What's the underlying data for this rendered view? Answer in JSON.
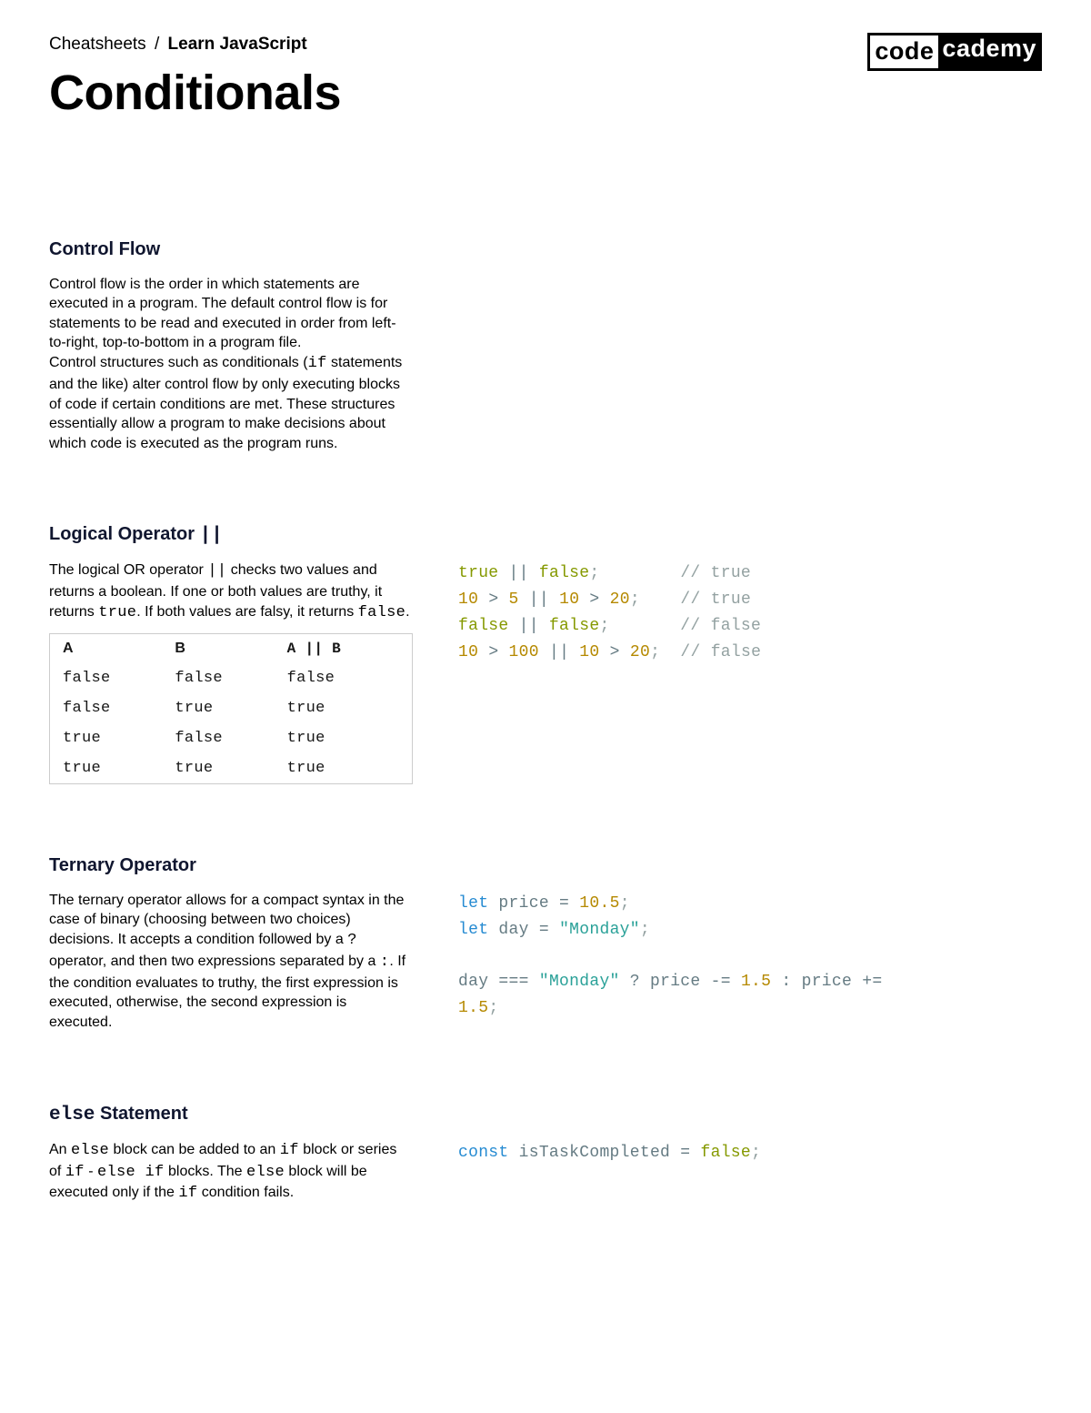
{
  "header": {
    "breadcrumb": {
      "root": "Cheatsheets",
      "sep": "/",
      "course": "Learn JavaScript"
    },
    "logo": {
      "left": "code",
      "right": "cademy"
    },
    "title": "Conditionals"
  },
  "sections": {
    "control_flow": {
      "heading": "Control Flow",
      "para1a": "Control flow is the order in which statements are executed in a program. The default control flow is for statements to be read and executed in order from left-to-right, top-to-bottom in a program file.",
      "para1b_a": "Control structures such as conditionals (",
      "para1b_code": "if",
      "para1b_b": " statements and the like) alter control flow by only executing blocks of code if certain conditions are met. These structures essentially allow a program to make decisions about which code is executed as the program runs."
    },
    "logical_or": {
      "heading_text": "Logical Operator ",
      "heading_op": "||",
      "p_a": "The logical OR operator ",
      "p_code1": "||",
      "p_b": " checks two values and returns a boolean. If one or both values are truthy, it returns ",
      "p_code2": "true",
      "p_c": ". If both values are falsy, it returns ",
      "p_code3": "false",
      "p_d": ".",
      "table": {
        "headers": {
          "a": "A",
          "b": "B",
          "ab": "A || B"
        },
        "rows": [
          {
            "a": "false",
            "b": "false",
            "r": "false"
          },
          {
            "a": "false",
            "b": "true",
            "r": "true"
          },
          {
            "a": "true",
            "b": "false",
            "r": "true"
          },
          {
            "a": "true",
            "b": "true",
            "r": "true"
          }
        ]
      },
      "code": {
        "l1": {
          "a": "true",
          "op1": "||",
          "b": "false",
          "semi": ";",
          "pad": "        ",
          "cm": "// true"
        },
        "l2": {
          "n1": "10",
          "op1": ">",
          "n2": "5",
          "op2": "||",
          "n3": "10",
          "op3": ">",
          "n4": "20",
          "semi": ";",
          "pad": "    ",
          "cm": "// true"
        },
        "l3": {
          "a": "false",
          "op1": "||",
          "b": "false",
          "semi": ";",
          "pad": "       ",
          "cm": "// false"
        },
        "l4": {
          "n1": "10",
          "op1": ">",
          "n2": "100",
          "op2": "||",
          "n3": "10",
          "op3": ">",
          "n4": "20",
          "semi": ";",
          "pad": "  ",
          "cm": "// false"
        }
      }
    },
    "ternary": {
      "heading": "Ternary Operator",
      "p_a": "The ternary operator allows for a compact syntax in the case of binary (choosing between two choices) decisions. It accepts a condition followed by a ",
      "p_q": "?",
      "p_b": " operator, and then two expressions separated by a ",
      "p_colon": ":",
      "p_c": ". If the condition evaluates to truthy, the first expression is executed, otherwise, the second expression is executed.",
      "code": {
        "l1": {
          "let": "let",
          "sp": " ",
          "id": "price",
          "sp2": " ",
          "eq": "=",
          "sp3": " ",
          "num": "10.5",
          "semi": ";"
        },
        "l2": {
          "let": "let",
          "sp": " ",
          "id": "day",
          "sp2": " ",
          "eq": "=",
          "sp3": " ",
          "str": "\"Monday\"",
          "semi": ";"
        },
        "blank": "",
        "l3": {
          "id1": "day",
          "sp1": " ",
          "op1": "===",
          "sp2": " ",
          "str": "\"Monday\"",
          "sp3": " ",
          "q": "?",
          "sp4": " ",
          "id2": "price",
          "sp5": " ",
          "op2": "-=",
          "sp6": " ",
          "num1": "1.5",
          "sp7": " ",
          "colon": ":",
          "sp8": " ",
          "id3": "price",
          "sp9": " ",
          "op3": "+=",
          "sp10": " ",
          "num2": "1.5",
          "semi": ";"
        }
      }
    },
    "else": {
      "heading_code": "else",
      "heading_text": " Statement",
      "p_a": "An ",
      "p_c1": "else",
      "p_b": " block can be added to an ",
      "p_c2": "if",
      "p_c": " block or series of ",
      "p_c3": "if",
      "p_d": " - ",
      "p_c4": "else if",
      "p_e": " blocks. The ",
      "p_c5": "else",
      "p_f": " block will be executed only if the ",
      "p_c6": "if",
      "p_g": " condition fails.",
      "code": {
        "l1": {
          "const": "const",
          "sp": " ",
          "id": "isTaskCompleted",
          "sp2": " ",
          "eq": "=",
          "sp3": " ",
          "val": "false",
          "semi": ";"
        }
      }
    }
  }
}
